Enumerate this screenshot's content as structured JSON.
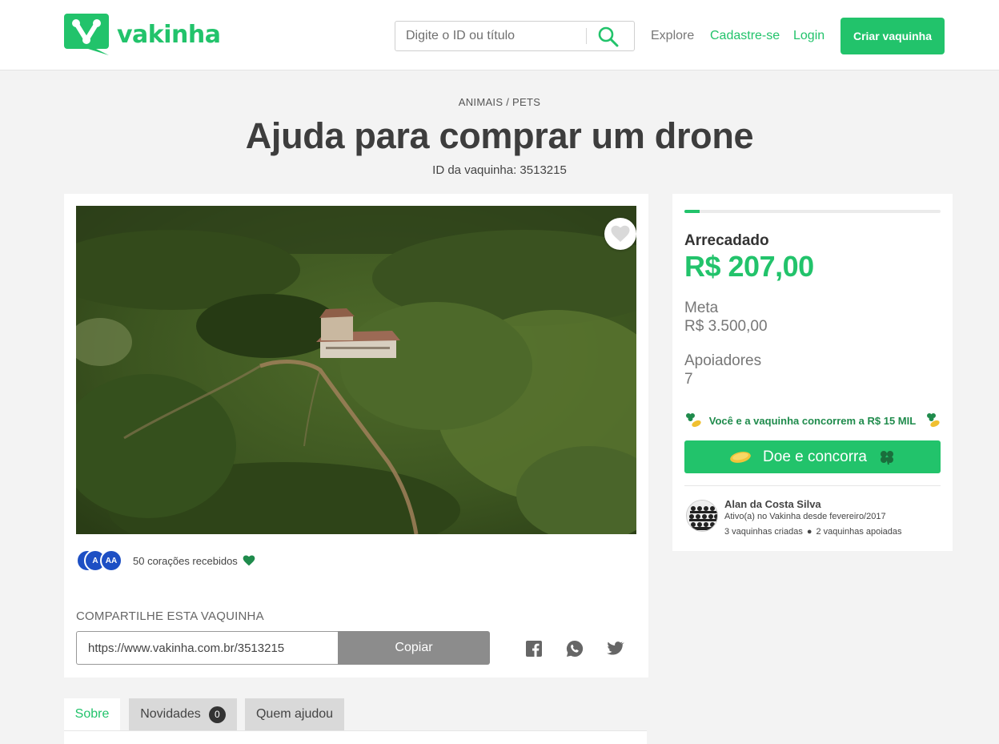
{
  "header": {
    "brand": "vakinha",
    "search_placeholder": "Digite o ID ou título",
    "nav": {
      "explore": "Explore",
      "signup": "Cadastre-se",
      "login": "Login"
    },
    "cta": "Criar vaquinha"
  },
  "campaign": {
    "category": "ANIMAIS / PETS",
    "title": "Ajuda para comprar um drone",
    "id_label": "ID da vaquinha: 3513215",
    "hearts_text": "50 corações recebidos",
    "avatar_initials": [
      "A",
      "A",
      "AA"
    ]
  },
  "share": {
    "label": "COMPARTILHE ESTA VAQUINHA",
    "url": "https://www.vakinha.com.br/3513215",
    "copy": "Copiar"
  },
  "stats": {
    "progress_fraction": 0.059,
    "raised_label": "Arrecadado",
    "raised": "R$ 207,00",
    "goal_label": "Meta",
    "goal": "R$ 3.500,00",
    "supporters_label": "Apoiadores",
    "supporters": "7",
    "promo": "Você e a vaquinha concorrem a R$ 15 MIL",
    "donate": "Doe e concorra"
  },
  "owner": {
    "name": "Alan da Costa Silva",
    "since": "Ativo(a) no Vakinha desde fevereiro/2017",
    "created": "3 vaquinhas criadas",
    "supported": "2 vaquinhas apoiadas"
  },
  "tabs": [
    {
      "label": "Sobre"
    },
    {
      "label": "Novidades",
      "count": "0"
    },
    {
      "label": "Quem ajudou"
    }
  ],
  "colors": {
    "brand": "#22c36b",
    "promo_text": "#1f8b4c",
    "avatar_blue": "#1d4fc4"
  },
  "icons": [
    "logo-v-icon",
    "search-icon",
    "heart-icon",
    "facebook-icon",
    "whatsapp-icon",
    "twitter-icon",
    "clover-icon",
    "coin-icon"
  ]
}
